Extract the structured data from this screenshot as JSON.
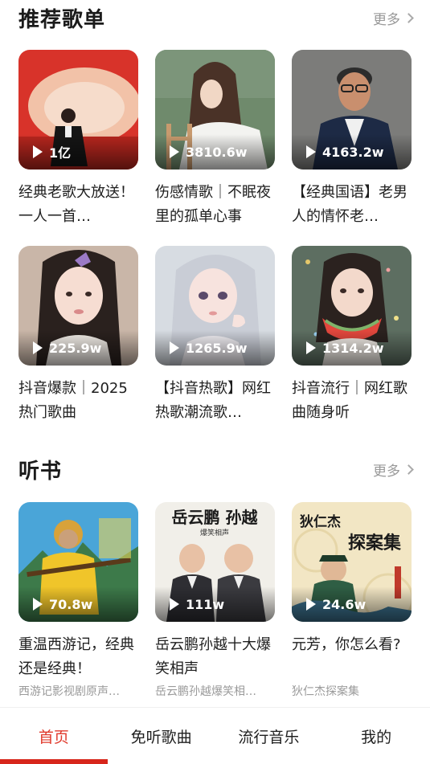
{
  "sections": {
    "playlists": {
      "title": "推荐歌单",
      "more_label": "更多",
      "items": [
        {
          "title": "经典老歌大放送！一人一首…",
          "play_count": "1亿"
        },
        {
          "title": "伤感情歌｜不眠夜里的孤单心事",
          "play_count": "3810.6w"
        },
        {
          "title": "【经典国语】老男人的情怀老…",
          "play_count": "4163.2w"
        },
        {
          "title": "抖音爆款｜2025热门歌曲",
          "play_count": "225.9w"
        },
        {
          "title": "【抖音热歌】网红热歌潮流歌…",
          "play_count": "1265.9w"
        },
        {
          "title": "抖音流行｜网红歌曲随身听",
          "play_count": "1314.2w"
        }
      ]
    },
    "audiobooks": {
      "title": "听书",
      "more_label": "更多",
      "items": [
        {
          "title": "重温西游记，经典还是经典！",
          "subtitle": "西游记影视剧原声…",
          "play_count": "70.8w"
        },
        {
          "title": "岳云鹏孙越十大爆笑相声",
          "subtitle": "岳云鹏孙越爆笑相…",
          "play_count": "111w",
          "cover_text": "岳云鹏 孙越",
          "cover_subtext": "爆笑相声"
        },
        {
          "title": "元芳，你怎么看?",
          "subtitle": "狄仁杰探案集",
          "play_count": "24.6w",
          "cover_text": "狄仁杰",
          "cover_text2": "探案集"
        }
      ]
    }
  },
  "nav": {
    "items": [
      "首页",
      "免听歌曲",
      "流行音乐",
      "我的"
    ],
    "active_index": 0
  },
  "colors": {
    "accent": "#d7261b",
    "active_text": "#e0392b",
    "more": "#999999"
  }
}
